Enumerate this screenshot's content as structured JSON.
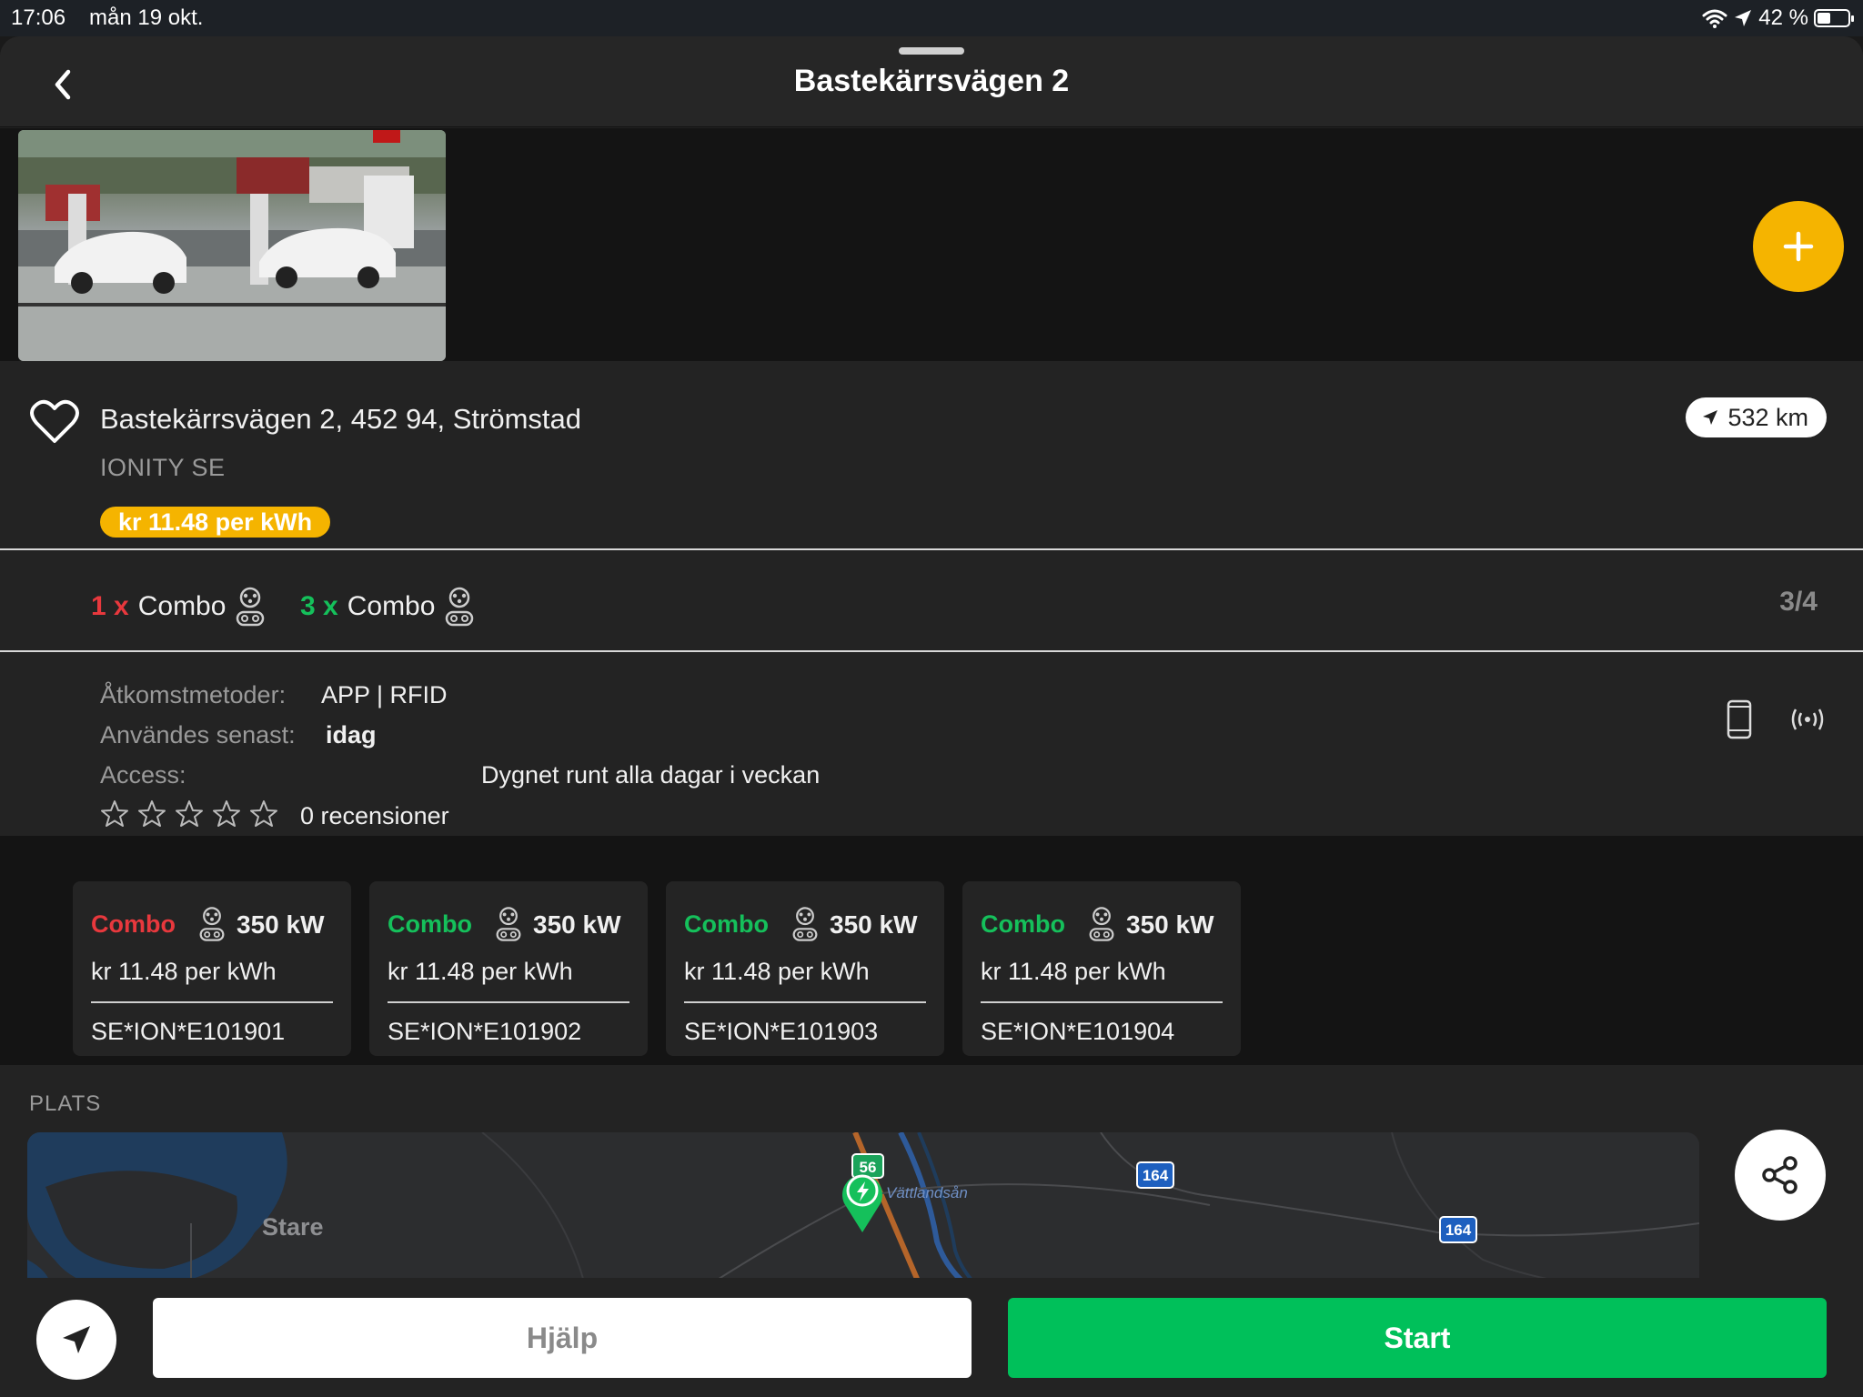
{
  "status_bar": {
    "time": "17:06",
    "date": "mån 19 okt.",
    "battery": "42 %",
    "icons": [
      "wifi-icon",
      "location-arrow-icon",
      "battery-icon"
    ]
  },
  "header": {
    "title": "Bastekärrsvägen 2"
  },
  "station": {
    "address": "Bastekärrsvägen 2, 452 94, Strömstad",
    "operator": "IONITY SE",
    "price_badge": "kr 11.48 per kWh",
    "distance": "532 km"
  },
  "connectors_summary": {
    "items": [
      {
        "count": "1 x",
        "type": "Combo",
        "status_color": "#e8383d"
      },
      {
        "count": "3 x",
        "type": "Combo",
        "status_color": "#15c05b"
      }
    ],
    "available_ratio": "3/4"
  },
  "details": {
    "access_methods_label": "Åtkomstmetoder:",
    "access_methods_value": "APP | RFID",
    "last_used_label": "Användes senast:",
    "last_used_value": "idag",
    "access_label": "Access:",
    "access_value": "Dygnet runt alla dagar i veckan",
    "rating_stars": 0,
    "reviews": "0 recensioner"
  },
  "evse_cards": [
    {
      "type": "Combo",
      "status_color": "#e8383d",
      "power": "350 kW",
      "price": "kr 11.48 per kWh",
      "evse_id": "SE*ION*E101901"
    },
    {
      "type": "Combo",
      "status_color": "#15c05b",
      "power": "350 kW",
      "price": "kr 11.48 per kWh",
      "evse_id": "SE*ION*E101902"
    },
    {
      "type": "Combo",
      "status_color": "#15c05b",
      "power": "350 kW",
      "price": "kr 11.48 per kWh",
      "evse_id": "SE*ION*E101903"
    },
    {
      "type": "Combo",
      "status_color": "#15c05b",
      "power": "350 kW",
      "price": "kr 11.48 per kWh",
      "evse_id": "SE*ION*E101904"
    }
  ],
  "location": {
    "section_label": "PLATS",
    "map_labels": {
      "town": "Stare",
      "river": "Vättlandsån",
      "road_56": "56",
      "road_164a": "164",
      "road_164b": "164"
    }
  },
  "actions": {
    "help_label": "Hjälp",
    "start_label": "Start"
  },
  "colors": {
    "accent_yellow": "#f5b400",
    "available_green": "#15c05b",
    "occupied_red": "#e8383d",
    "start_green": "#00c05a"
  }
}
